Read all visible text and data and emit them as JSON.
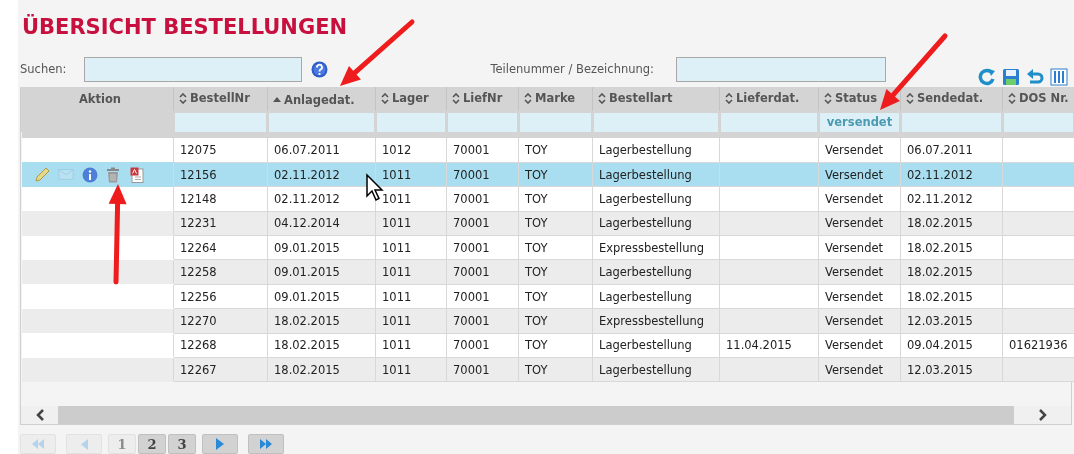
{
  "title": "ÜBERSICHT BESTELLUNGEN",
  "search": {
    "label": "Suchen:"
  },
  "part_search": {
    "label": "Teilenummer / Bezeichnung:"
  },
  "toolbar": [
    {
      "kind": "refresh"
    },
    {
      "kind": "save"
    },
    {
      "kind": "undo"
    },
    {
      "kind": "columns"
    }
  ],
  "table": {
    "columns": [
      {
        "label": "Aktion",
        "kind": "action"
      },
      {
        "label": "BestellNr",
        "kind": "data",
        "sorted": false
      },
      {
        "label": "Anlagedat.",
        "kind": "data",
        "sorted": true
      },
      {
        "label": "Lager",
        "kind": "data",
        "sorted": false
      },
      {
        "label": "LiefNr",
        "kind": "data",
        "sorted": false
      },
      {
        "label": "Marke",
        "kind": "data",
        "sorted": false
      },
      {
        "label": "Bestellart",
        "kind": "data",
        "sorted": false
      },
      {
        "label": "Lieferdat.",
        "kind": "data",
        "sorted": false
      },
      {
        "label": "Status",
        "kind": "data",
        "sorted": false,
        "filter": "versendet"
      },
      {
        "label": "Sendedat.",
        "kind": "data",
        "sorted": false
      },
      {
        "label": "DOS Nr.",
        "kind": "data",
        "sorted": false
      }
    ],
    "rows": [
      {
        "selected": false,
        "cells": [
          "",
          "12075",
          "06.07.2011",
          "1012",
          "70001",
          "TOY",
          "Lagerbestellung",
          null,
          "Versendet",
          "06.07.2011",
          null
        ]
      },
      {
        "selected": true,
        "actions": [
          {
            "kind": "edit",
            "disabled": false
          },
          {
            "kind": "mail",
            "disabled": true
          },
          {
            "kind": "info",
            "disabled": false
          },
          {
            "kind": "delete",
            "disabled": false
          },
          {
            "kind": "pdf",
            "disabled": false
          }
        ],
        "cells": [
          "",
          "12156",
          "02.11.2012",
          "1011",
          "70001",
          "TOY",
          "Lagerbestellung",
          null,
          "Versendet",
          "02.11.2012",
          null
        ]
      },
      {
        "selected": false,
        "cells": [
          "",
          "12148",
          "02.11.2012",
          "1011",
          "70001",
          "TOY",
          "Lagerbestellung",
          null,
          "Versendet",
          "02.11.2012",
          null
        ]
      },
      {
        "selected": false,
        "cells": [
          "",
          "12231",
          "04.12.2014",
          "1011",
          "70001",
          "TOY",
          "Lagerbestellung",
          null,
          "Versendet",
          "18.02.2015",
          null
        ]
      },
      {
        "selected": false,
        "cells": [
          "",
          "12264",
          "09.01.2015",
          "1011",
          "70001",
          "TOY",
          "Expressbestellung",
          null,
          "Versendet",
          "18.02.2015",
          null
        ]
      },
      {
        "selected": false,
        "cells": [
          "",
          "12258",
          "09.01.2015",
          "1011",
          "70001",
          "TOY",
          "Lagerbestellung",
          null,
          "Versendet",
          "18.02.2015",
          null
        ]
      },
      {
        "selected": false,
        "cells": [
          "",
          "12256",
          "09.01.2015",
          "1011",
          "70001",
          "TOY",
          "Lagerbestellung",
          null,
          "Versendet",
          "18.02.2015",
          null
        ]
      },
      {
        "selected": false,
        "cells": [
          "",
          "12270",
          "18.02.2015",
          "1011",
          "70001",
          "TOY",
          "Expressbestellung",
          null,
          "Versendet",
          "12.03.2015",
          null
        ]
      },
      {
        "selected": false,
        "cells": [
          "",
          "12268",
          "18.02.2015",
          "1011",
          "70001",
          "TOY",
          "Lagerbestellung",
          "11.04.2015",
          "Versendet",
          "09.04.2015",
          "01621936"
        ]
      },
      {
        "selected": false,
        "cells": [
          "",
          "12267",
          "18.02.2015",
          "1011",
          "70001",
          "TOY",
          "Lagerbestellung",
          null,
          "Versendet",
          "12.03.2015",
          null
        ]
      }
    ]
  },
  "pager": [
    {
      "kind": "first",
      "disabled": true
    },
    {
      "kind": "prev",
      "disabled": true
    },
    {
      "kind": "page",
      "label": "1",
      "selected": true
    },
    {
      "kind": "page",
      "label": "2",
      "selected": false
    },
    {
      "kind": "page",
      "label": "3",
      "selected": false
    },
    {
      "kind": "next",
      "disabled": false
    },
    {
      "kind": "last",
      "disabled": false
    }
  ]
}
